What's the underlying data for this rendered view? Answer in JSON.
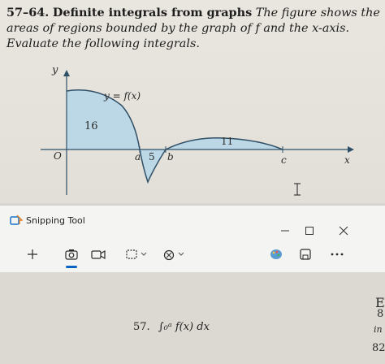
{
  "book": {
    "heading_num": "57–64.",
    "heading_title": "Definite integrals from graphs",
    "heading_body": "The figure shows the areas of regions bounded by the graph of f and the x-axis. Evaluate the following integrals.",
    "graph": {
      "y_axis_label": "y",
      "x_axis_label": "x",
      "function_label": "y = f(x)",
      "origin_label": "O",
      "area_1": "16",
      "area_2": "5",
      "area_3": "11",
      "point_a": "a",
      "point_b": "b",
      "point_c": "c"
    },
    "problem_57_number": "57.",
    "problem_57_expr": "∫₀ᵃ f(x) dx",
    "edge_1": "E",
    "edge_2": "8",
    "edge_3": "in",
    "edge_4": "82"
  },
  "snipping_tool": {
    "title": "Snipping Tool",
    "icons": {
      "logo": "snipping-tool-logo-icon",
      "new": "plus-icon",
      "screenshot": "camera-icon",
      "video": "video-icon",
      "mode": "rectangle-mode-icon",
      "delay": "timer-icon",
      "edit": "paint-icon",
      "save": "save-icon",
      "more": "more-icon",
      "minimize": "minimize-icon",
      "maximize": "maximize-icon",
      "close": "close-icon"
    },
    "accent_color": "#0b63c5"
  }
}
